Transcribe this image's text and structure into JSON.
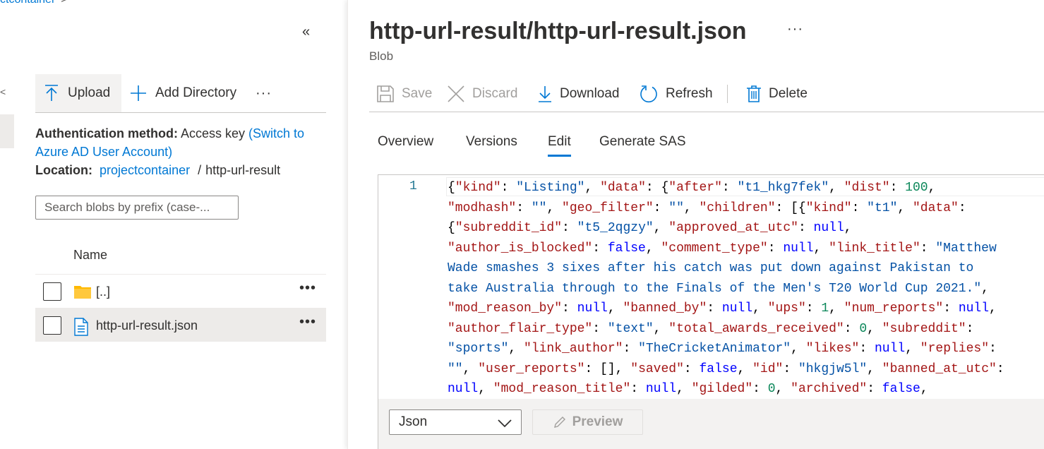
{
  "breadcrumb": {
    "text": "ctcontainer",
    "separator": ">"
  },
  "left_pane": {
    "collapse_glyph": "«",
    "edge_glyph": "<",
    "toolbar": {
      "upload": "Upload",
      "add_directory": "Add Directory",
      "more": "···"
    },
    "auth": {
      "label": "Authentication method:",
      "value": "Access key",
      "switch_link_1": "(Switch to",
      "switch_link_2": "Azure AD User Account)"
    },
    "location": {
      "label": "Location:",
      "container": "projectcontainer",
      "separator": "/",
      "folder": "http-url-result"
    },
    "search": {
      "placeholder": "Search blobs by prefix (case-..."
    },
    "list": {
      "header": "Name",
      "rows": [
        {
          "name": "[..]",
          "icon": "folder-icon",
          "more": "•••"
        },
        {
          "name": "http-url-result.json",
          "icon": "file-icon",
          "more": "•••"
        }
      ]
    }
  },
  "blob": {
    "title": "http-url-result/http-url-result.json",
    "more": "···",
    "subtitle": "Blob"
  },
  "commands": {
    "save": "Save",
    "discard": "Discard",
    "download": "Download",
    "refresh": "Refresh",
    "delete": "Delete"
  },
  "tabs": [
    "Overview",
    "Versions",
    "Edit",
    "Generate SAS"
  ],
  "active_tab": "Edit",
  "editor": {
    "line_number": "1",
    "code_lines": [
      [
        [
          "p",
          "{"
        ],
        [
          "k",
          "\"kind\""
        ],
        [
          "p",
          ": "
        ],
        [
          "s",
          "\"Listing\""
        ],
        [
          "p",
          ", "
        ],
        [
          "k",
          "\"data\""
        ],
        [
          "p",
          ": {"
        ],
        [
          "k",
          "\"after\""
        ],
        [
          "p",
          ": "
        ],
        [
          "s",
          "\"t1_hkg7fek\""
        ],
        [
          "p",
          ", "
        ],
        [
          "k",
          "\"dist\""
        ],
        [
          "p",
          ": "
        ],
        [
          "n",
          "100"
        ],
        [
          "p",
          ","
        ]
      ],
      [
        [
          "k",
          "\"modhash\""
        ],
        [
          "p",
          ": "
        ],
        [
          "s",
          "\"\""
        ],
        [
          "p",
          ", "
        ],
        [
          "k",
          "\"geo_filter\""
        ],
        [
          "p",
          ": "
        ],
        [
          "s",
          "\"\""
        ],
        [
          "p",
          ", "
        ],
        [
          "k",
          "\"children\""
        ],
        [
          "p",
          ": [{"
        ],
        [
          "k",
          "\"kind\""
        ],
        [
          "p",
          ": "
        ],
        [
          "s",
          "\"t1\""
        ],
        [
          "p",
          ", "
        ],
        [
          "k",
          "\"data\""
        ],
        [
          "p",
          ":"
        ]
      ],
      [
        [
          "p",
          "{"
        ],
        [
          "k",
          "\"subreddit_id\""
        ],
        [
          "p",
          ": "
        ],
        [
          "s",
          "\"t5_2qgzy\""
        ],
        [
          "p",
          ", "
        ],
        [
          "k",
          "\"approved_at_utc\""
        ],
        [
          "p",
          ": "
        ],
        [
          "b",
          "null"
        ],
        [
          "p",
          ","
        ]
      ],
      [
        [
          "k",
          "\"author_is_blocked\""
        ],
        [
          "p",
          ": "
        ],
        [
          "b",
          "false"
        ],
        [
          "p",
          ", "
        ],
        [
          "k",
          "\"comment_type\""
        ],
        [
          "p",
          ": "
        ],
        [
          "b",
          "null"
        ],
        [
          "p",
          ", "
        ],
        [
          "k",
          "\"link_title\""
        ],
        [
          "p",
          ": "
        ],
        [
          "s",
          "\"Matthew"
        ]
      ],
      [
        [
          "s",
          "Wade smashes 3 sixes after his catch was put down against Pakistan to"
        ]
      ],
      [
        [
          "s",
          "take Australia through to the Finals of the Men's T20 World Cup 2021.\""
        ],
        [
          "p",
          ","
        ]
      ],
      [
        [
          "k",
          "\"mod_reason_by\""
        ],
        [
          "p",
          ": "
        ],
        [
          "b",
          "null"
        ],
        [
          "p",
          ", "
        ],
        [
          "k",
          "\"banned_by\""
        ],
        [
          "p",
          ": "
        ],
        [
          "b",
          "null"
        ],
        [
          "p",
          ", "
        ],
        [
          "k",
          "\"ups\""
        ],
        [
          "p",
          ": "
        ],
        [
          "n",
          "1"
        ],
        [
          "p",
          ", "
        ],
        [
          "k",
          "\"num_reports\""
        ],
        [
          "p",
          ": "
        ],
        [
          "b",
          "null"
        ],
        [
          "p",
          ","
        ]
      ],
      [
        [
          "k",
          "\"author_flair_type\""
        ],
        [
          "p",
          ": "
        ],
        [
          "s",
          "\"text\""
        ],
        [
          "p",
          ", "
        ],
        [
          "k",
          "\"total_awards_received\""
        ],
        [
          "p",
          ": "
        ],
        [
          "n",
          "0"
        ],
        [
          "p",
          ", "
        ],
        [
          "k",
          "\"subreddit\""
        ],
        [
          "p",
          ":"
        ]
      ],
      [
        [
          "s",
          "\"sports\""
        ],
        [
          "p",
          ", "
        ],
        [
          "k",
          "\"link_author\""
        ],
        [
          "p",
          ": "
        ],
        [
          "s",
          "\"TheCricketAnimator\""
        ],
        [
          "p",
          ", "
        ],
        [
          "k",
          "\"likes\""
        ],
        [
          "p",
          ": "
        ],
        [
          "b",
          "null"
        ],
        [
          "p",
          ", "
        ],
        [
          "k",
          "\"replies\""
        ],
        [
          "p",
          ":"
        ]
      ],
      [
        [
          "s",
          "\"\""
        ],
        [
          "p",
          ", "
        ],
        [
          "k",
          "\"user_reports\""
        ],
        [
          "p",
          ": [], "
        ],
        [
          "k",
          "\"saved\""
        ],
        [
          "p",
          ": "
        ],
        [
          "b",
          "false"
        ],
        [
          "p",
          ", "
        ],
        [
          "k",
          "\"id\""
        ],
        [
          "p",
          ": "
        ],
        [
          "s",
          "\"hkgjw5l\""
        ],
        [
          "p",
          ", "
        ],
        [
          "k",
          "\"banned_at_utc\""
        ],
        [
          "p",
          ":"
        ]
      ],
      [
        [
          "b",
          "null"
        ],
        [
          "p",
          ", "
        ],
        [
          "k",
          "\"mod_reason_title\""
        ],
        [
          "p",
          ": "
        ],
        [
          "b",
          "null"
        ],
        [
          "p",
          ", "
        ],
        [
          "k",
          "\"gilded\""
        ],
        [
          "p",
          ": "
        ],
        [
          "n",
          "0"
        ],
        [
          "p",
          ", "
        ],
        [
          "k",
          "\"archived\""
        ],
        [
          "p",
          ": "
        ],
        [
          "b",
          "false"
        ],
        [
          "p",
          ","
        ]
      ]
    ],
    "language": "Json",
    "preview": "Preview"
  },
  "colors": {
    "accent": "#0078d4",
    "json_key": "#a31515",
    "json_string": "#0451a5",
    "json_number": "#098658",
    "json_literal": "#0000ff",
    "folder": "#ffb900"
  }
}
